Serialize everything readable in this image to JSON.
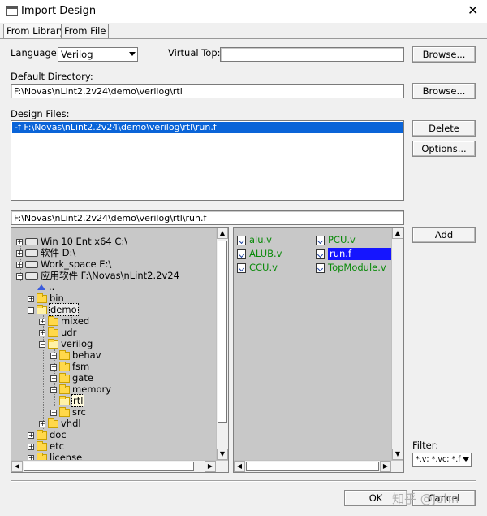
{
  "window": {
    "title": "Import Design",
    "close_glyph": "✕"
  },
  "tabs": [
    {
      "label": "From Library"
    },
    {
      "label": "From File"
    }
  ],
  "language": {
    "label": "Language:",
    "value": "Verilog"
  },
  "virtual_top": {
    "label": "Virtual Top:",
    "value": ""
  },
  "default_dir": {
    "label": "Default Directory:",
    "value": "F:\\Novas\\nLint2.2v24\\demo\\verilog\\rtl"
  },
  "design_files": {
    "label": "Design Files:",
    "items": [
      "-f F:\\Novas\\nLint2.2v24\\demo\\verilog\\rtl\\run.f"
    ]
  },
  "buttons": {
    "browse1": "Browse...",
    "browse2": "Browse...",
    "delete": "Delete",
    "options": "Options...",
    "add": "Add",
    "ok": "OK",
    "cancel": "Cancel"
  },
  "path_field": {
    "value": "F:\\Novas\\nLint2.2v24\\demo\\verilog\\rtl\\run.f"
  },
  "tree": [
    {
      "label": "Win 10 Ent x64 C:\\"
    },
    {
      "label": "软件 D:\\"
    },
    {
      "label": "Work_space E:\\"
    },
    {
      "label": "应用软件 F:\\Novas\\nLint2.2v24"
    },
    {
      "label": ".."
    },
    {
      "label": "bin"
    },
    {
      "label": "demo"
    },
    {
      "label": "mixed"
    },
    {
      "label": "udr"
    },
    {
      "label": "verilog"
    },
    {
      "label": "behav"
    },
    {
      "label": "fsm"
    },
    {
      "label": "gate"
    },
    {
      "label": "memory"
    },
    {
      "label": "rtl"
    },
    {
      "label": "src"
    },
    {
      "label": "vhdl"
    },
    {
      "label": "doc"
    },
    {
      "label": "etc"
    },
    {
      "label": "license"
    }
  ],
  "files": [
    {
      "name": "alu.v"
    },
    {
      "name": "ALUB.v"
    },
    {
      "name": "CCU.v"
    },
    {
      "name": "PCU.v"
    },
    {
      "name": "run.f"
    },
    {
      "name": "TopModule.v"
    }
  ],
  "filter": {
    "label": "Filter:",
    "value": "*.v; *.vc; *.f"
  },
  "watermark": "知乎 @John",
  "colors": {
    "selection": "#0a64d8",
    "verilog_file": "#0a8a0a",
    "highlight": "#1515ff"
  }
}
